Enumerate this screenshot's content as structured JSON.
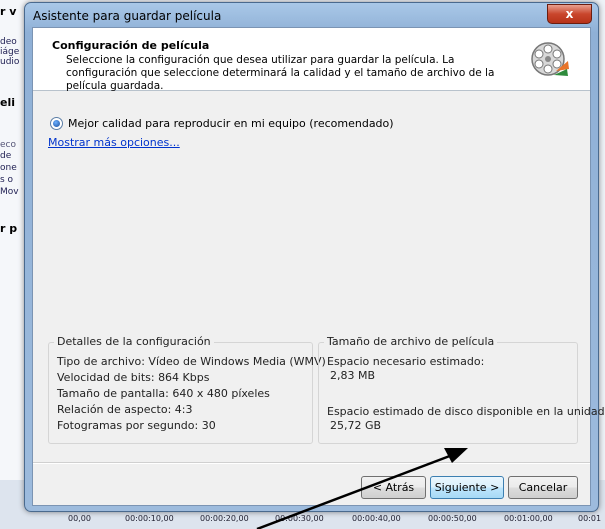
{
  "background": {
    "left_fragments": [
      "r v",
      "deo",
      "iáge",
      "udio",
      "eli",
      "eco",
      "de",
      "one",
      "s o",
      "Mov",
      "r p"
    ],
    "timeline": [
      "00,00",
      "00:00:10,00",
      "00:00:20,00",
      "00:00:30,00",
      "00:00:40,00",
      "00:00:50,00",
      "00:01:00,00",
      "00:01"
    ]
  },
  "window": {
    "title": "Asistente para guardar película",
    "close_label": "x"
  },
  "header": {
    "title": "Configuración de película",
    "description": "Seleccione la configuración que desea utilizar para guardar la película. La configuración que seleccione determinará la calidad y el tamaño de archivo de la película guardada."
  },
  "options": {
    "selected_option": "Mejor calidad para reproducir en mi equipo (recomendado)",
    "more_link": "Mostrar más opciones..."
  },
  "details": {
    "legend": "Detalles de la configuración",
    "lines": [
      "Tipo de archivo: Vídeo de Windows Media (WMV)",
      "Velocidad de bits: 864 Kbps",
      "Tamaño de pantalla: 640 x 480 píxeles",
      "Relación de aspecto: 4:3",
      "Fotogramas por segundo: 30"
    ]
  },
  "filesize": {
    "legend": "Tamaño de archivo de película",
    "needed_label": "Espacio necesario estimado:",
    "needed_value": "2,83 MB",
    "available_label": "Espacio estimado de disco disponible en la unidad C:",
    "available_value": "25,72 GB"
  },
  "buttons": {
    "back": "< Atrás",
    "next": "Siguiente >",
    "cancel": "Cancelar"
  },
  "icons": {
    "wizard": "film-reel-icon",
    "annotation": "arrow-annotation"
  }
}
